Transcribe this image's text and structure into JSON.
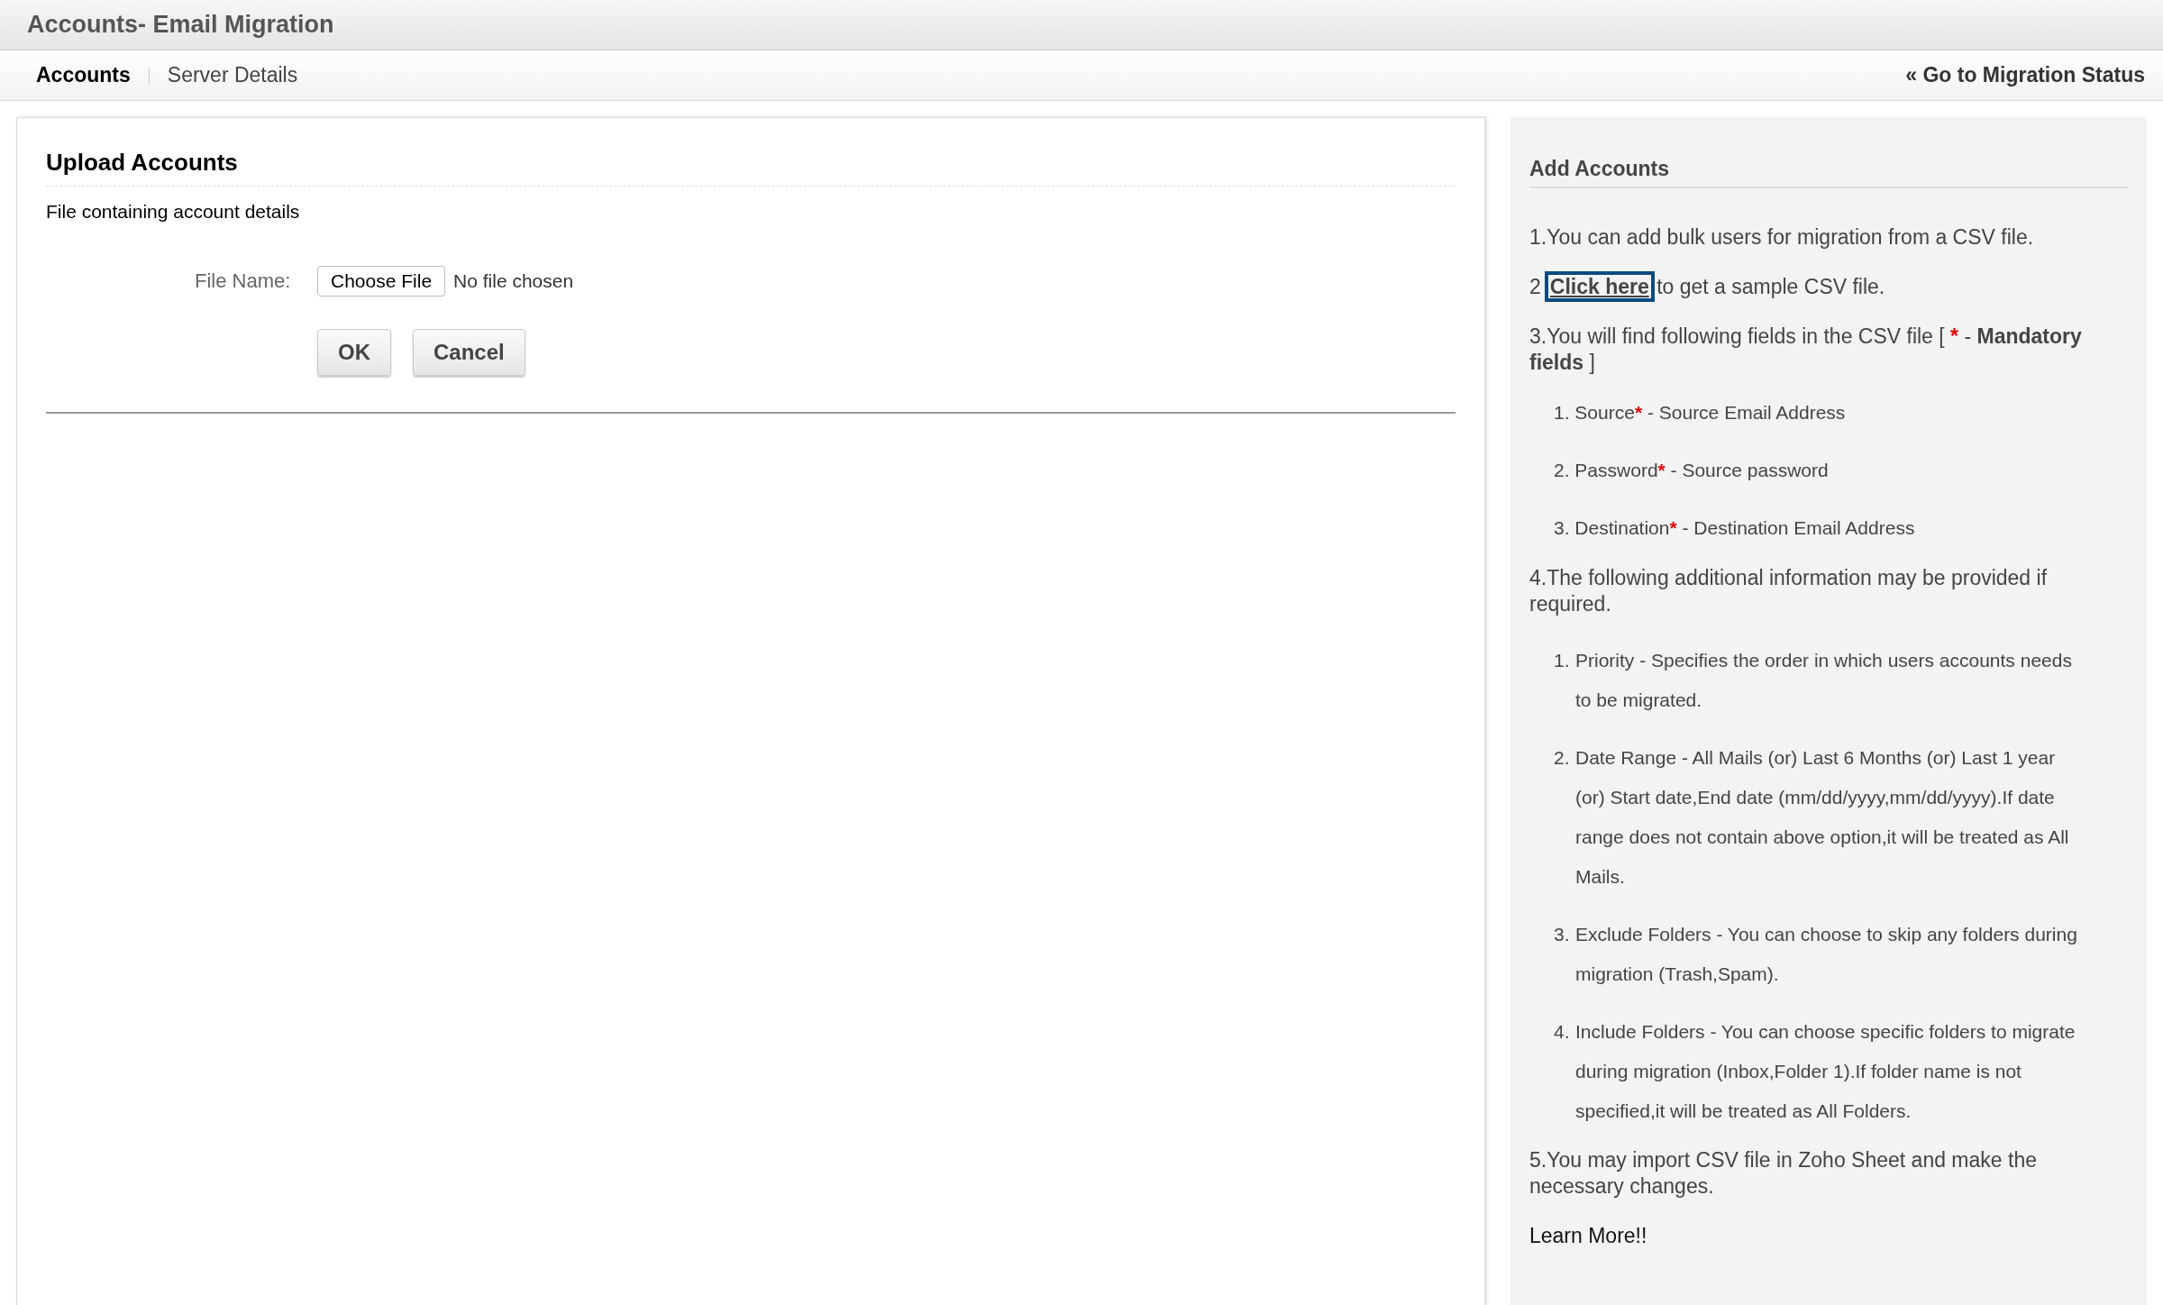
{
  "window": {
    "title": "Accounts- Email Migration"
  },
  "tabs": [
    {
      "label": "Accounts",
      "selected": true
    },
    {
      "label": "Server Details",
      "selected": false
    }
  ],
  "migration_link": "« Go to Migration Status",
  "upload": {
    "heading": "Upload Accounts",
    "subtitle": "File containing account details",
    "file_label": "File Name:",
    "choose_button": "Choose File",
    "file_status": "No file chosen",
    "buttons": [
      "OK",
      "Cancel"
    ]
  },
  "help": {
    "heading": "Add Accounts",
    "blocks": [
      {
        "kind": "text",
        "text": "1.You can add bulk users for migration from a CSV file."
      },
      {
        "kind": "link",
        "prefix": "2",
        "link": "Click here",
        "focused": true,
        "text": "to get a sample CSV file."
      },
      {
        "kind": "legend",
        "text": "3.You will find following fields in the CSV file [",
        "mark": "*",
        "rest": "- **Mandatory fields** ]"
      },
      {
        "kind": "fields",
        "items": [
          {
            "number": "1.",
            "name": "Source",
            "mark": "*",
            "description": "- Source Email Address"
          },
          {
            "number": "2.",
            "name": "Password",
            "mark": "*",
            "description": "- Source password"
          },
          {
            "number": "3.",
            "name": "Destination",
            "mark": "*",
            "description": "- Destination Email Address"
          }
        ]
      },
      {
        "kind": "text",
        "text": "4.The following additional information may be provided if required."
      },
      {
        "kind": "options",
        "items": [
          {
            "number": "1.",
            "text": "Priority - Specifies the order in which users accounts needs to be migrated."
          },
          {
            "number": "2.",
            "text": "Date Range - All Mails (or) Last 6 Months (or) Last 1 year (or) Start date,End date (mm/dd/yyyy,mm/dd/yyyy).If date range does not contain above option,it will be treated as All Mails."
          },
          {
            "number": "3.",
            "text": "Exclude Folders - You can choose to skip any folders during migration (Trash,Spam)."
          },
          {
            "number": "4.",
            "text": "Include Folders - You can choose specific folders to migrate during migration (Inbox,Folder 1).If folder name is not specified,it will be treated as All Folders."
          }
        ]
      },
      {
        "kind": "text",
        "text": "5.You may import CSV file in Zoho Sheet and make the necessary changes."
      },
      {
        "kind": "learn",
        "text": "Learn More!!"
      }
    ]
  }
}
